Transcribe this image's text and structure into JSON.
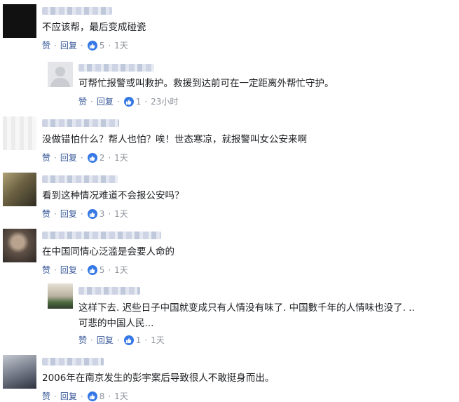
{
  "comments": [
    {
      "text": "不应该帮，最后变成碰瓷",
      "like_label": "赞",
      "reply_label": "回复",
      "likes": "5",
      "time": "1天",
      "avatar_colors": [
        "#111111",
        "#222222"
      ]
    },
    {
      "text": "可帮忙报警或叫救护。救援到达前可在一定距离外帮忙守护。",
      "like_label": "赞",
      "reply_label": "回复",
      "likes": "1",
      "time": "23小时",
      "avatar_colors": [
        "#e3e5e8",
        "#c9ccd1"
      ]
    },
    {
      "text": "没做错怕什么？帮人也怕？唉！世态寒凉，就报警叫女公安来啊",
      "like_label": "赞",
      "reply_label": "回复",
      "likes": "2",
      "time": "1天",
      "avatar_colors": [
        "#e6e6e6",
        "#f2f2f2"
      ]
    },
    {
      "text": "看到这种情况难道不会报公安吗？",
      "like_label": "赞",
      "reply_label": "回复",
      "likes": "3",
      "time": "1天",
      "avatar_colors": [
        "#8a7d55",
        "#4a4535"
      ]
    },
    {
      "text": "在中国同情心泛滥是会要人命的",
      "like_label": "赞",
      "reply_label": "回复",
      "likes": "5",
      "time": "1天",
      "avatar_colors": [
        "#6f6257",
        "#3d3530"
      ]
    },
    {
      "text_line1": "这样下去. 迟些日子中国就变成只有人情没有味了. 中国數千年的人情味也没了. ..",
      "text_line2": "可悲的中国人民...",
      "like_label": "赞",
      "reply_label": "回复",
      "likes": "1",
      "time": "1天",
      "avatar_colors": [
        "#5f7a4e",
        "#c7c0b2"
      ]
    },
    {
      "text": "2006年在南京发生的彭宇案后导致很人不敢挺身而出。",
      "like_label": "赞",
      "reply_label": "回复",
      "likes": "8",
      "time": "1天",
      "avatar_colors": [
        "#9aa0aa",
        "#3d4250"
      ]
    }
  ],
  "colors": {
    "link": "#385898",
    "like_badge": "#3578e5",
    "meta": "#90949c"
  },
  "icons": {
    "like_badge": "thumbs-up-icon"
  }
}
